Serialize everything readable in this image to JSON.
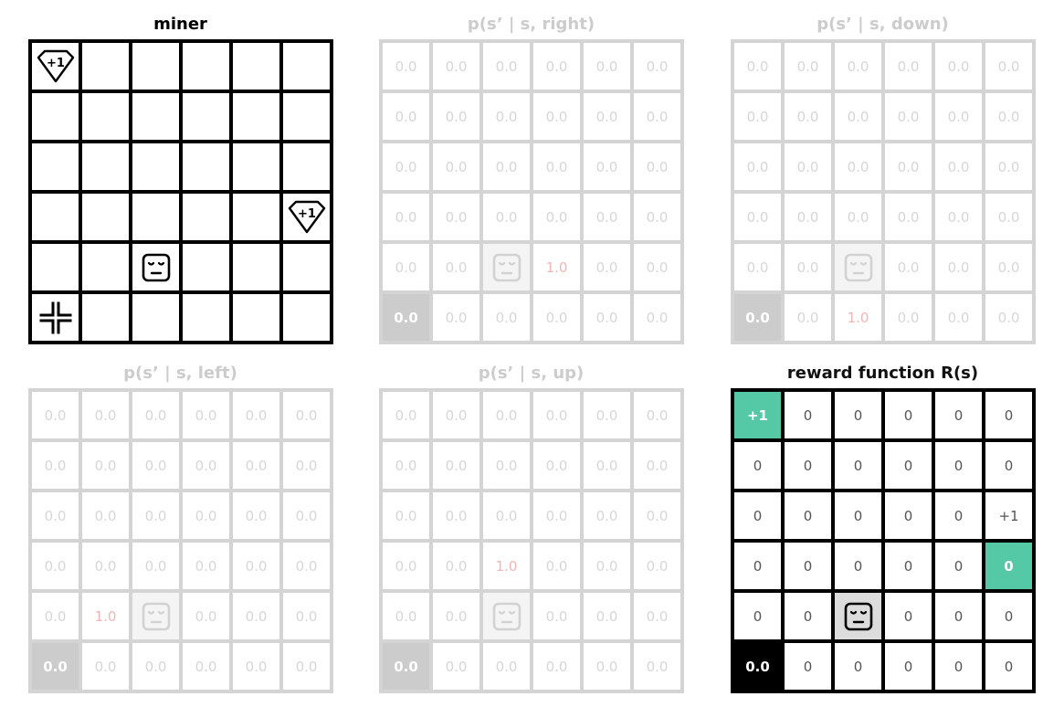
{
  "panels": {
    "miner": {
      "title": "miner",
      "icons": [
        "gem-plus-one-icon",
        "robot-face-icon",
        "home-base-icon"
      ],
      "gem_label": "+1"
    },
    "right": {
      "title": "p(s’ | s, right)"
    },
    "down": {
      "title": "p(s’ | s, down)"
    },
    "left": {
      "title": "p(s’ | s, left)"
    },
    "up": {
      "title": "p(s’ | s, up)"
    },
    "reward": {
      "title": "reward function R(s)"
    }
  },
  "grid": {
    "size": 6,
    "agent_cell": [
      4,
      2
    ],
    "home_cell": [
      5,
      0
    ],
    "gem_cells": [
      [
        0,
        0
      ],
      [
        3,
        5
      ]
    ]
  },
  "transitions": {
    "right": [
      [
        "0.0",
        "0.0",
        "0.0",
        "0.0",
        "0.0",
        "0.0"
      ],
      [
        "0.0",
        "0.0",
        "0.0",
        "0.0",
        "0.0",
        "0.0"
      ],
      [
        "0.0",
        "0.0",
        "0.0",
        "0.0",
        "0.0",
        "0.0"
      ],
      [
        "0.0",
        "0.0",
        "0.0",
        "0.0",
        "0.0",
        "0.0"
      ],
      [
        "0.0",
        "0.0",
        "",
        "1.0",
        "0.0",
        "0.0"
      ],
      [
        "0.0",
        "0.0",
        "0.0",
        "0.0",
        "0.0",
        "0.0"
      ]
    ],
    "down": [
      [
        "0.0",
        "0.0",
        "0.0",
        "0.0",
        "0.0",
        "0.0"
      ],
      [
        "0.0",
        "0.0",
        "0.0",
        "0.0",
        "0.0",
        "0.0"
      ],
      [
        "0.0",
        "0.0",
        "0.0",
        "0.0",
        "0.0",
        "0.0"
      ],
      [
        "0.0",
        "0.0",
        "0.0",
        "0.0",
        "0.0",
        "0.0"
      ],
      [
        "0.0",
        "0.0",
        "",
        "0.0",
        "0.0",
        "0.0"
      ],
      [
        "0.0",
        "0.0",
        "1.0",
        "0.0",
        "0.0",
        "0.0"
      ]
    ],
    "left": [
      [
        "0.0",
        "0.0",
        "0.0",
        "0.0",
        "0.0",
        "0.0"
      ],
      [
        "0.0",
        "0.0",
        "0.0",
        "0.0",
        "0.0",
        "0.0"
      ],
      [
        "0.0",
        "0.0",
        "0.0",
        "0.0",
        "0.0",
        "0.0"
      ],
      [
        "0.0",
        "0.0",
        "0.0",
        "0.0",
        "0.0",
        "0.0"
      ],
      [
        "0.0",
        "1.0",
        "",
        "0.0",
        "0.0",
        "0.0"
      ],
      [
        "0.0",
        "0.0",
        "0.0",
        "0.0",
        "0.0",
        "0.0"
      ]
    ],
    "up": [
      [
        "0.0",
        "0.0",
        "0.0",
        "0.0",
        "0.0",
        "0.0"
      ],
      [
        "0.0",
        "0.0",
        "0.0",
        "0.0",
        "0.0",
        "0.0"
      ],
      [
        "0.0",
        "0.0",
        "0.0",
        "0.0",
        "0.0",
        "0.0"
      ],
      [
        "0.0",
        "0.0",
        "1.0",
        "0.0",
        "0.0",
        "0.0"
      ],
      [
        "0.0",
        "0.0",
        "",
        "0.0",
        "0.0",
        "0.0"
      ],
      [
        "0.0",
        "0.0",
        "0.0",
        "0.0",
        "0.0",
        "0.0"
      ]
    ]
  },
  "reward": [
    [
      "+1",
      "0",
      "0",
      "0",
      "0",
      "0"
    ],
    [
      "0",
      "0",
      "0",
      "0",
      "0",
      "0"
    ],
    [
      "0",
      "0",
      "0",
      "0",
      "0",
      "+1"
    ],
    [
      "0",
      "0",
      "0",
      "0",
      "0",
      "0"
    ],
    [
      "0",
      "0",
      "",
      "0",
      "0",
      "0"
    ],
    [
      "0.0",
      "0",
      "0",
      "0",
      "0",
      "0"
    ]
  ],
  "colors": {
    "faded_text": "#d6d6d6",
    "faded_line": "#d4d4d4",
    "highlight_text": "#f2b5b5",
    "home_faded": "#cccccc",
    "gem_green": "#55c8a6",
    "agent_bg": "#dcdcdc"
  }
}
